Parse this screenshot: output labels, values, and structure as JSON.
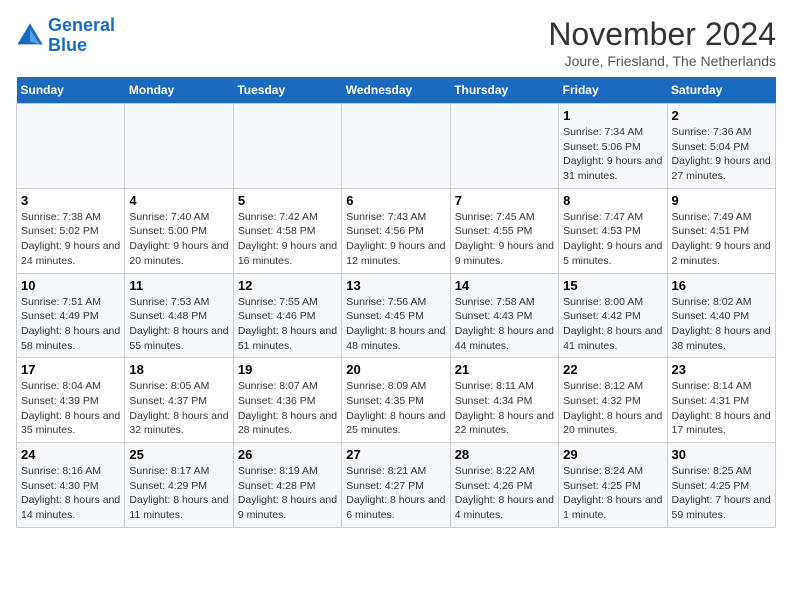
{
  "logo": {
    "line1": "General",
    "line2": "Blue"
  },
  "title": "November 2024",
  "location": "Joure, Friesland, The Netherlands",
  "headers": [
    "Sunday",
    "Monday",
    "Tuesday",
    "Wednesday",
    "Thursday",
    "Friday",
    "Saturday"
  ],
  "weeks": [
    [
      {
        "day": "",
        "info": ""
      },
      {
        "day": "",
        "info": ""
      },
      {
        "day": "",
        "info": ""
      },
      {
        "day": "",
        "info": ""
      },
      {
        "day": "",
        "info": ""
      },
      {
        "day": "1",
        "info": "Sunrise: 7:34 AM\nSunset: 5:06 PM\nDaylight: 9 hours and 31 minutes."
      },
      {
        "day": "2",
        "info": "Sunrise: 7:36 AM\nSunset: 5:04 PM\nDaylight: 9 hours and 27 minutes."
      }
    ],
    [
      {
        "day": "3",
        "info": "Sunrise: 7:38 AM\nSunset: 5:02 PM\nDaylight: 9 hours and 24 minutes."
      },
      {
        "day": "4",
        "info": "Sunrise: 7:40 AM\nSunset: 5:00 PM\nDaylight: 9 hours and 20 minutes."
      },
      {
        "day": "5",
        "info": "Sunrise: 7:42 AM\nSunset: 4:58 PM\nDaylight: 9 hours and 16 minutes."
      },
      {
        "day": "6",
        "info": "Sunrise: 7:43 AM\nSunset: 4:56 PM\nDaylight: 9 hours and 12 minutes."
      },
      {
        "day": "7",
        "info": "Sunrise: 7:45 AM\nSunset: 4:55 PM\nDaylight: 9 hours and 9 minutes."
      },
      {
        "day": "8",
        "info": "Sunrise: 7:47 AM\nSunset: 4:53 PM\nDaylight: 9 hours and 5 minutes."
      },
      {
        "day": "9",
        "info": "Sunrise: 7:49 AM\nSunset: 4:51 PM\nDaylight: 9 hours and 2 minutes."
      }
    ],
    [
      {
        "day": "10",
        "info": "Sunrise: 7:51 AM\nSunset: 4:49 PM\nDaylight: 8 hours and 58 minutes."
      },
      {
        "day": "11",
        "info": "Sunrise: 7:53 AM\nSunset: 4:48 PM\nDaylight: 8 hours and 55 minutes."
      },
      {
        "day": "12",
        "info": "Sunrise: 7:55 AM\nSunset: 4:46 PM\nDaylight: 8 hours and 51 minutes."
      },
      {
        "day": "13",
        "info": "Sunrise: 7:56 AM\nSunset: 4:45 PM\nDaylight: 8 hours and 48 minutes."
      },
      {
        "day": "14",
        "info": "Sunrise: 7:58 AM\nSunset: 4:43 PM\nDaylight: 8 hours and 44 minutes."
      },
      {
        "day": "15",
        "info": "Sunrise: 8:00 AM\nSunset: 4:42 PM\nDaylight: 8 hours and 41 minutes."
      },
      {
        "day": "16",
        "info": "Sunrise: 8:02 AM\nSunset: 4:40 PM\nDaylight: 8 hours and 38 minutes."
      }
    ],
    [
      {
        "day": "17",
        "info": "Sunrise: 8:04 AM\nSunset: 4:39 PM\nDaylight: 8 hours and 35 minutes."
      },
      {
        "day": "18",
        "info": "Sunrise: 8:05 AM\nSunset: 4:37 PM\nDaylight: 8 hours and 32 minutes."
      },
      {
        "day": "19",
        "info": "Sunrise: 8:07 AM\nSunset: 4:36 PM\nDaylight: 8 hours and 28 minutes."
      },
      {
        "day": "20",
        "info": "Sunrise: 8:09 AM\nSunset: 4:35 PM\nDaylight: 8 hours and 25 minutes."
      },
      {
        "day": "21",
        "info": "Sunrise: 8:11 AM\nSunset: 4:34 PM\nDaylight: 8 hours and 22 minutes."
      },
      {
        "day": "22",
        "info": "Sunrise: 8:12 AM\nSunset: 4:32 PM\nDaylight: 8 hours and 20 minutes."
      },
      {
        "day": "23",
        "info": "Sunrise: 8:14 AM\nSunset: 4:31 PM\nDaylight: 8 hours and 17 minutes."
      }
    ],
    [
      {
        "day": "24",
        "info": "Sunrise: 8:16 AM\nSunset: 4:30 PM\nDaylight: 8 hours and 14 minutes."
      },
      {
        "day": "25",
        "info": "Sunrise: 8:17 AM\nSunset: 4:29 PM\nDaylight: 8 hours and 11 minutes."
      },
      {
        "day": "26",
        "info": "Sunrise: 8:19 AM\nSunset: 4:28 PM\nDaylight: 8 hours and 9 minutes."
      },
      {
        "day": "27",
        "info": "Sunrise: 8:21 AM\nSunset: 4:27 PM\nDaylight: 8 hours and 6 minutes."
      },
      {
        "day": "28",
        "info": "Sunrise: 8:22 AM\nSunset: 4:26 PM\nDaylight: 8 hours and 4 minutes."
      },
      {
        "day": "29",
        "info": "Sunrise: 8:24 AM\nSunset: 4:25 PM\nDaylight: 8 hours and 1 minute."
      },
      {
        "day": "30",
        "info": "Sunrise: 8:25 AM\nSunset: 4:25 PM\nDaylight: 7 hours and 59 minutes."
      }
    ]
  ]
}
